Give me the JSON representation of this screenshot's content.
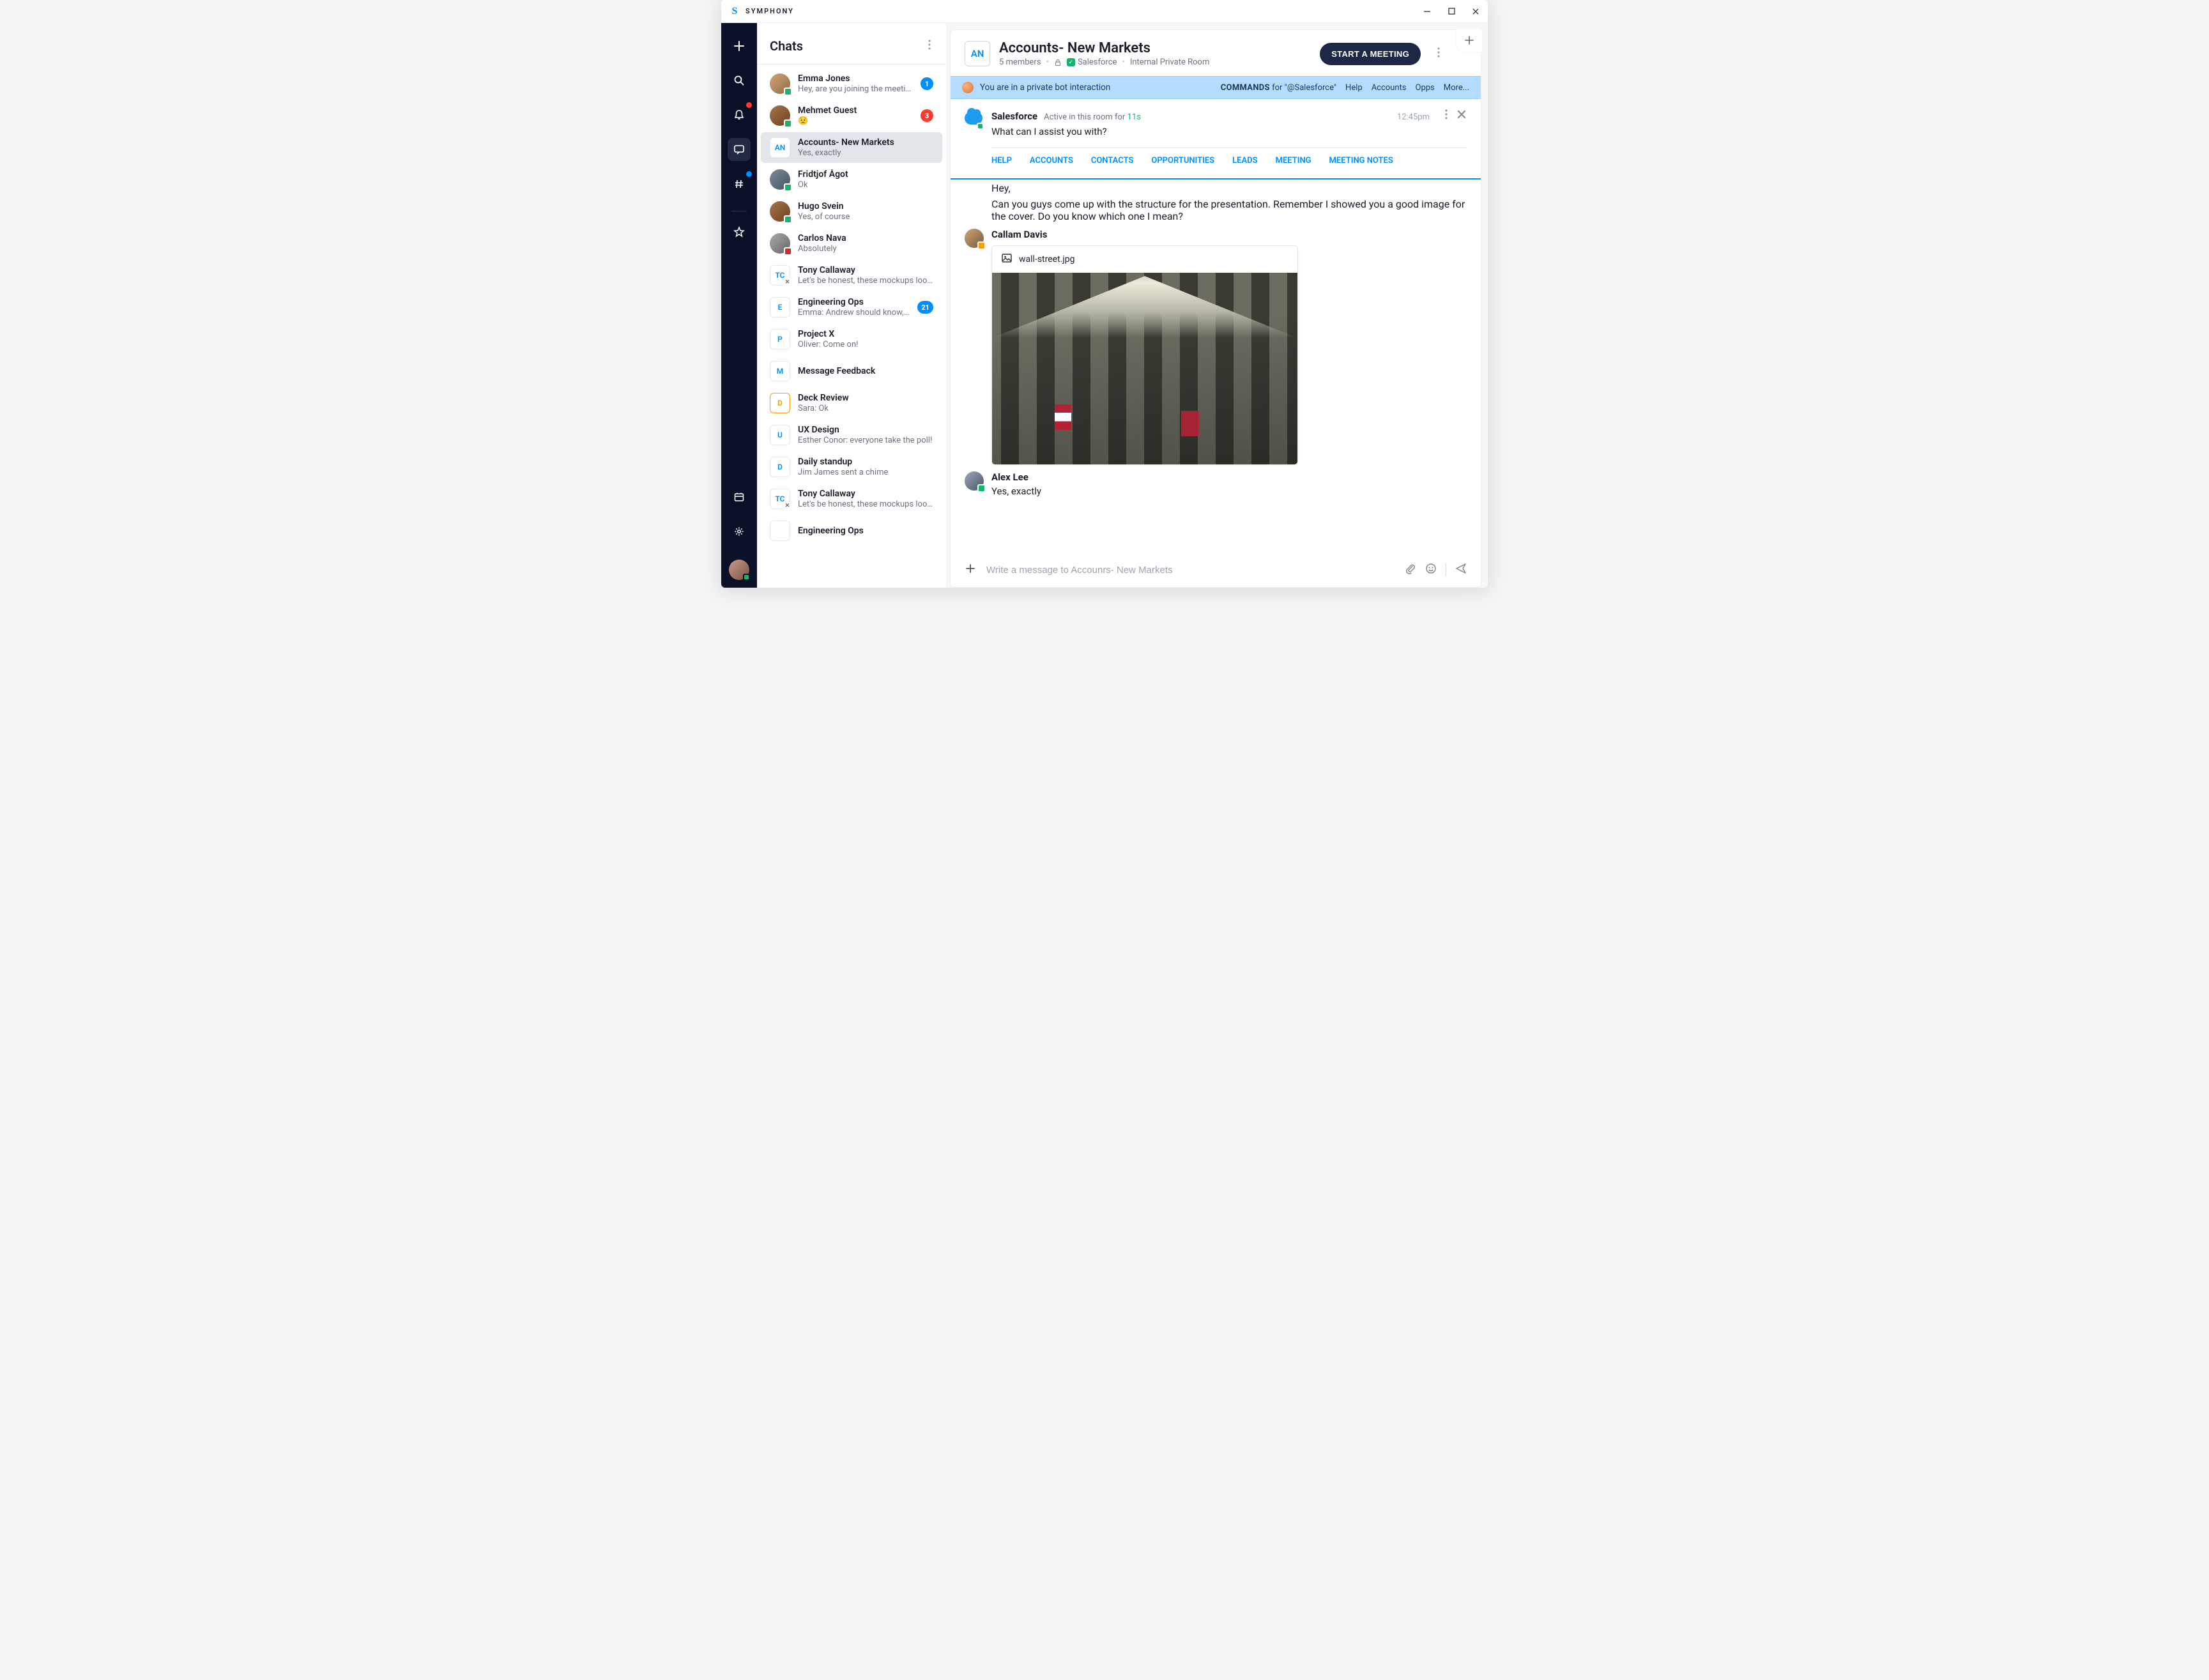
{
  "app": {
    "name": "SYMPHONY"
  },
  "sidebar": {
    "title": "Chats"
  },
  "chats": [
    {
      "name": "Emma Jones",
      "preview": "Hey, are you joining the meeting?",
      "badge": "1",
      "badge_color": "blue",
      "avatar_type": "photo",
      "avatar_variant": "",
      "presence": "green"
    },
    {
      "name": "Mehmet Guest",
      "preview": "😟",
      "badge": "3",
      "badge_color": "red",
      "avatar_type": "photo",
      "avatar_variant": "p2",
      "presence": "green"
    },
    {
      "name": "Accounts- New Markets",
      "preview": "Yes, exactly",
      "avatar_type": "initials",
      "initials": "AN",
      "selected": true
    },
    {
      "name": "Fridtjof Ågot",
      "preview": "Ok",
      "avatar_type": "photo",
      "avatar_variant": "p3",
      "presence": "green"
    },
    {
      "name": "Hugo Svein",
      "preview": "Yes, of course",
      "avatar_type": "photo",
      "avatar_variant": "p2",
      "presence": "green"
    },
    {
      "name": "Carlos Nava",
      "preview": "Absolutely",
      "avatar_type": "photo",
      "avatar_variant": "p4",
      "presence": "red"
    },
    {
      "name": "Tony Callaway",
      "preview": "Let's be honest, these mockups look gre…",
      "avatar_type": "initials",
      "initials": "TC",
      "presence": "x"
    },
    {
      "name": "Engineering Ops",
      "preview": "Emma: Andrew should know, pass…",
      "badge": "21",
      "badge_color": "blue",
      "avatar_type": "initials",
      "initials": "E"
    },
    {
      "name": "Project X",
      "preview": "Oliver: Come on!",
      "avatar_type": "initials",
      "initials": "P"
    },
    {
      "name": "Message Feedback",
      "preview": "",
      "avatar_type": "initials",
      "initials": "M"
    },
    {
      "name": "Deck Review",
      "preview": "Sara: Ok",
      "avatar_type": "initials",
      "initials": "D",
      "avatar_variant": "amber"
    },
    {
      "name": "UX Design",
      "preview": "Esther Conor: everyone take the poll!",
      "avatar_type": "initials",
      "initials": "U"
    },
    {
      "name": "Daily standup",
      "preview": "Jim James sent a chime",
      "avatar_type": "initials",
      "initials": "D"
    },
    {
      "name": "Tony Callaway",
      "preview": "Let's be honest, these mockups look great!",
      "avatar_type": "initials",
      "initials": "TC",
      "presence": "x"
    },
    {
      "name": "Engineering Ops",
      "preview": "",
      "avatar_type": "initials",
      "initials": ""
    }
  ],
  "room": {
    "initials": "AN",
    "title": "Accounts- New Markets",
    "members": "5 members",
    "chip_label": "Salesforce",
    "type": "Internal Private Room",
    "start_meeting": "START A MEETING"
  },
  "banner": {
    "text": "You are in a private bot interaction",
    "commands_label": "COMMANDS",
    "commands_for": "for \"@Salesforce\"",
    "links": [
      "Help",
      "Accounts",
      "Opps",
      "More..."
    ]
  },
  "bot": {
    "name": "Salesforce",
    "status_prefix": "Active in this room for",
    "status_time": "11s",
    "time": "12:45pm",
    "message": "What can I assist you with?",
    "links": [
      "HELP",
      "ACCOUNTS",
      "CONTACTS",
      "OPPORTUNITIES",
      "LEADS",
      "MEETING",
      "MEETING NOTES"
    ]
  },
  "messages": {
    "frag_hey": "Hey,",
    "frag_body": "Can you guys come up with the structure for the presentation. Remember I showed you a good image for the cover. Do you know which one I mean?",
    "callam_name": "Callam Davis",
    "attachment_name": "wall-street.jpg",
    "alex_name": "Alex Lee",
    "alex_msg": "Yes, exactly"
  },
  "composer": {
    "placeholder": "Write a message to Accounrs- New Markets"
  }
}
